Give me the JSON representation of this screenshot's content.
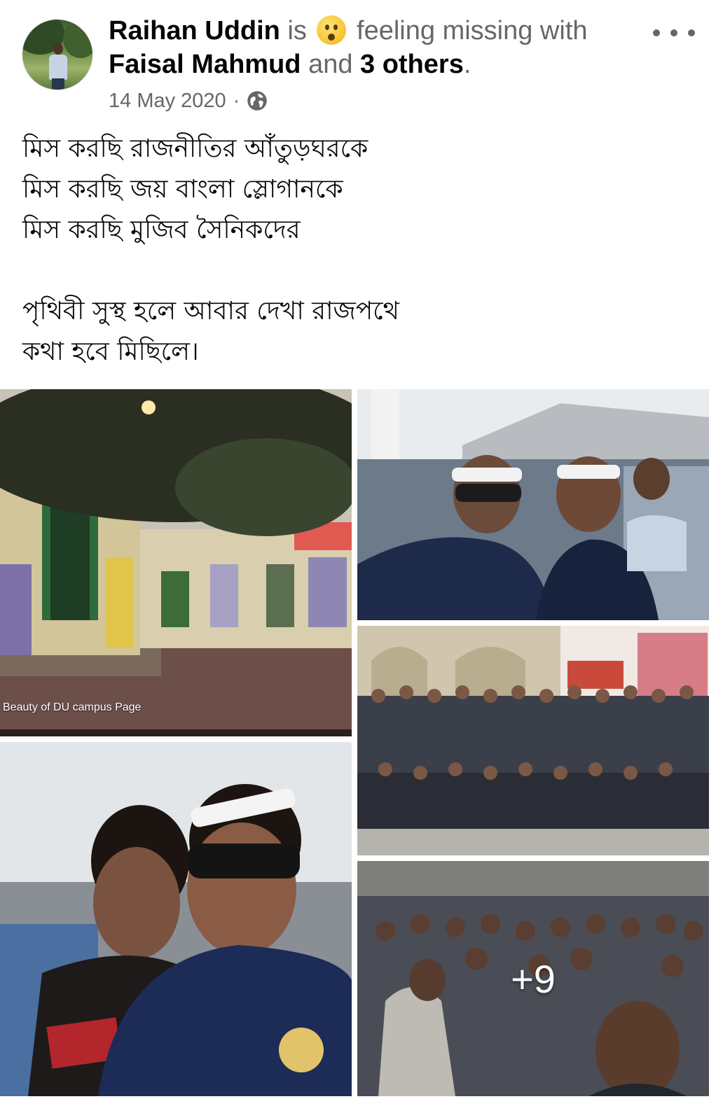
{
  "post": {
    "author": "Raihan Uddin",
    "is_text": "is",
    "feeling_text": "feeling missing with",
    "tagged_person": "Faisal Mahmud",
    "and_text": "and",
    "others": "3 others",
    "period": ".",
    "date": "14 May 2020",
    "separator": "·",
    "privacy_icon": "globe-icon",
    "feeling_icon": "wow-face-emoji",
    "body": "মিস করছি রাজনীতির আঁতুড়ঘরকে\nমিস করছি জয় বাংলা স্লোগানকে\nমিস করছি মুজিব সৈনিকদের\n\nপৃথিবী সুস্থ হলে আবার দেখা রাজপথে\nকথা হবে মিছিলে।"
  },
  "photos": {
    "watermark": "Beauty of DU campus Page",
    "more_count": "+9"
  },
  "colors": {
    "primary_text": "#050505",
    "secondary_text": "#65676b"
  }
}
